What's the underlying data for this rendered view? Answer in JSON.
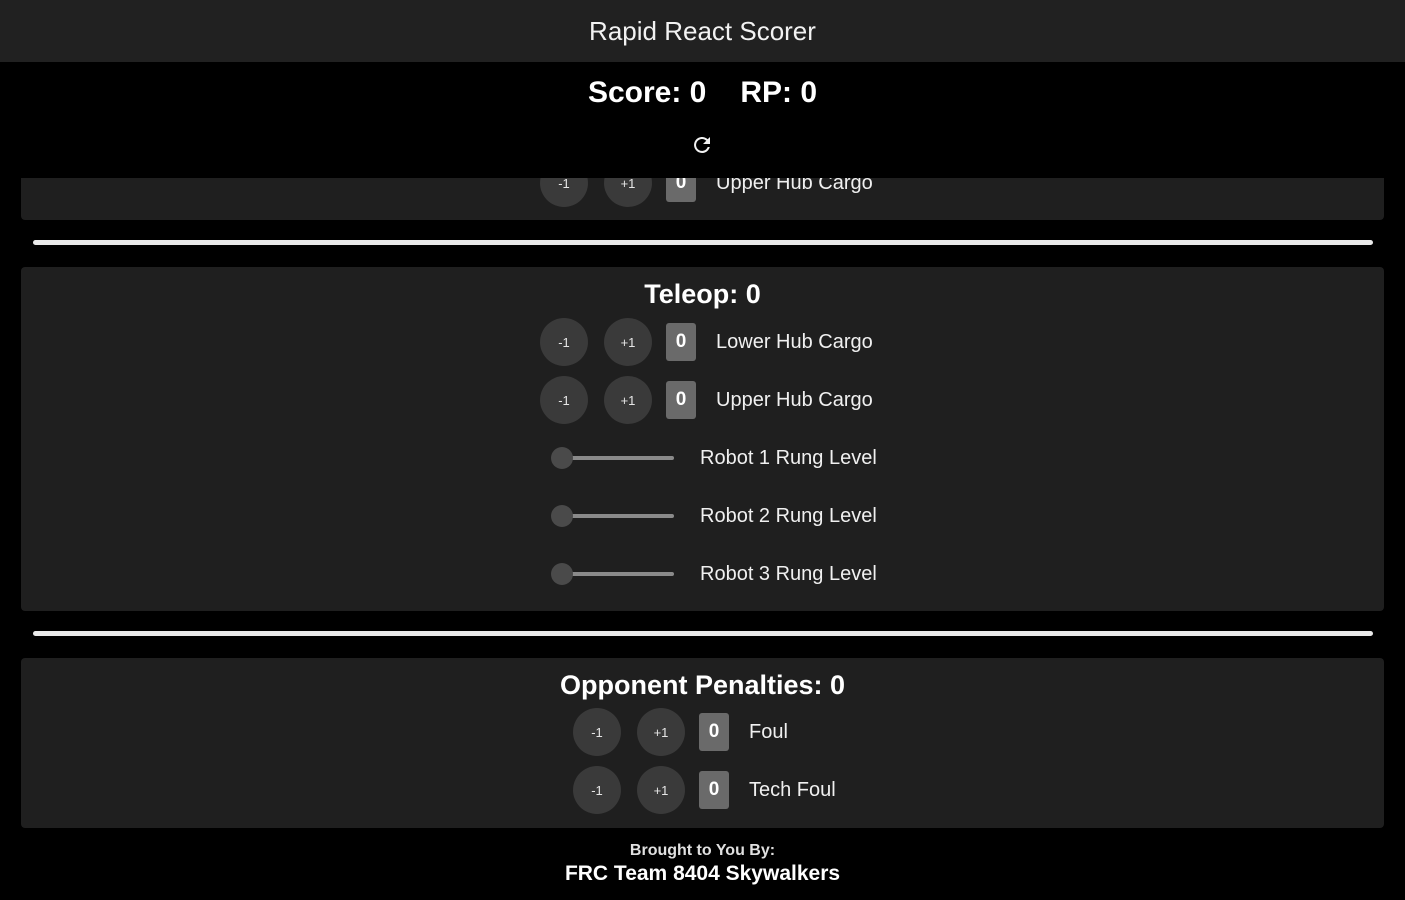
{
  "app": {
    "title": "Rapid React Scorer"
  },
  "summary": {
    "score_text": "Score: 0",
    "rp_text": "RP: 0",
    "reset_icon": "refresh-icon"
  },
  "auto_partial": {
    "counters": [
      {
        "minus": "-1",
        "plus": "+1",
        "value": "0",
        "label": "Upper Hub Cargo"
      }
    ]
  },
  "teleop": {
    "title": "Teleop: 0",
    "counters": [
      {
        "minus": "-1",
        "plus": "+1",
        "value": "0",
        "label": "Lower Hub Cargo"
      },
      {
        "minus": "-1",
        "plus": "+1",
        "value": "0",
        "label": "Upper Hub Cargo"
      }
    ],
    "sliders": [
      {
        "label": "Robot 1 Rung Level",
        "value": 0
      },
      {
        "label": "Robot 2 Rung Level",
        "value": 0
      },
      {
        "label": "Robot 3 Rung Level",
        "value": 0
      }
    ]
  },
  "penalties": {
    "title": "Opponent Penalties: 0",
    "counters": [
      {
        "minus": "-1",
        "plus": "+1",
        "value": "0",
        "label": "Foul"
      },
      {
        "minus": "-1",
        "plus": "+1",
        "value": "0",
        "label": "Tech Foul"
      }
    ]
  },
  "footer": {
    "line1": "Brought to You By:",
    "line2": "FRC Team 8404 Skywalkers"
  },
  "colors": {
    "background": "#000000",
    "card": "#1f1f1f",
    "appbar": "#212121",
    "round_button": "#3a3a3a",
    "value_box": "#6a6a6a",
    "divider": "#eaeaea"
  }
}
